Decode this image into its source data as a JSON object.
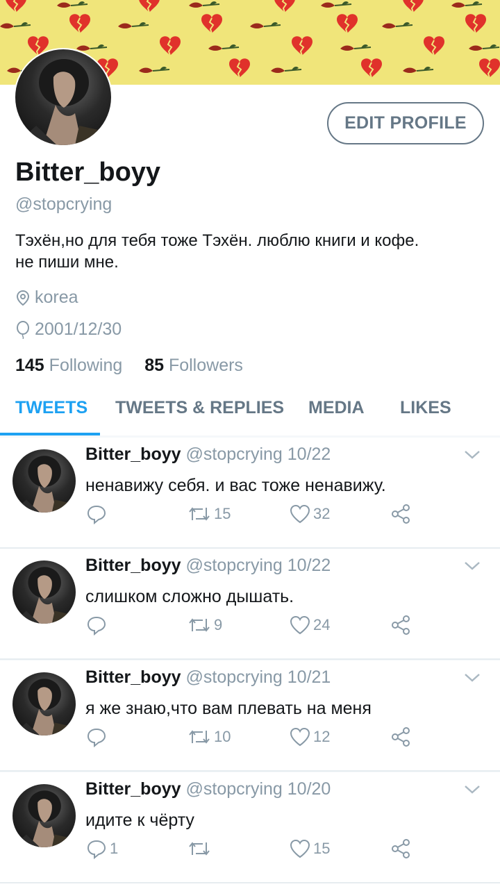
{
  "profile": {
    "name": "Bitter_boyy",
    "handle": "@stopcrying",
    "bio_line1": "Тэхён,но для тебя тоже Тэхён. люблю книги и кофе.",
    "bio_line2": "не пиши мне.",
    "location": "korea",
    "birthday": "2001/12/30",
    "following_count": "145",
    "following_label": "Following",
    "followers_count": "85",
    "followers_label": "Followers",
    "edit_button": "EDIT PROFILE"
  },
  "tabs": [
    {
      "label": "TWEETS",
      "active": true
    },
    {
      "label": "TWEETS & REPLIES",
      "active": false
    },
    {
      "label": "MEDIA",
      "active": false
    },
    {
      "label": "LIKES",
      "active": false
    }
  ],
  "tweets": [
    {
      "name": "Bitter_boyy",
      "meta": "@stopcrying 10/22",
      "text": "ненавижу себя. и вас тоже ненавижу.",
      "replies": "",
      "retweets": "15",
      "likes": "32"
    },
    {
      "name": "Bitter_boyy",
      "meta": "@stopcrying 10/22",
      "text": "слишком сложно дышать.",
      "replies": "",
      "retweets": "9",
      "likes": "24"
    },
    {
      "name": "Bitter_boyy",
      "meta": "@stopcrying 10/21",
      "text": "я же знаю,что вам плевать на меня",
      "replies": "",
      "retweets": "10",
      "likes": "12"
    },
    {
      "name": "Bitter_boyy",
      "meta": "@stopcrying 10/20",
      "text": "идите к чёрту",
      "replies": "1",
      "retweets": "",
      "likes": "15"
    }
  ],
  "colors": {
    "accent": "#1da1f2",
    "muted": "#8899a6",
    "banner": "#f0e57a",
    "heart_red": "#e0322b"
  },
  "icons": {
    "location": "location-pin-icon",
    "birthday": "balloon-icon",
    "reply": "reply-icon",
    "retweet": "retweet-icon",
    "like": "heart-icon",
    "share": "share-icon",
    "more": "chevron-down-icon"
  }
}
